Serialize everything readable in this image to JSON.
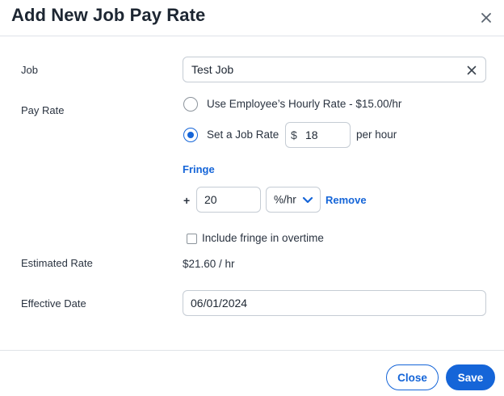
{
  "dialog": {
    "title": "Add New Job Pay Rate"
  },
  "job": {
    "label": "Job",
    "value": "Test Job"
  },
  "pay_rate": {
    "label": "Pay Rate",
    "option_hourly": "Use Employee’s Hourly Rate - $15.00/hr",
    "option_job_rate": "Set a Job Rate",
    "currency_symbol": "$",
    "rate_value": "18",
    "rate_suffix": "per hour",
    "selected": "job_rate"
  },
  "fringe": {
    "heading": "Fringe",
    "plus": "+",
    "value": "20",
    "unit": "%/hr",
    "remove_label": "Remove",
    "include_overtime_label": "Include fringe in overtime",
    "include_overtime_checked": false
  },
  "estimated_rate": {
    "label": "Estimated Rate",
    "value": "$21.60 / hr"
  },
  "effective_date": {
    "label": "Effective Date",
    "value": "06/01/2024"
  },
  "footer": {
    "close_label": "Close",
    "save_label": "Save"
  },
  "colors": {
    "accent": "#1565d8",
    "text": "#2a3340",
    "border": "#c5ccd4"
  }
}
